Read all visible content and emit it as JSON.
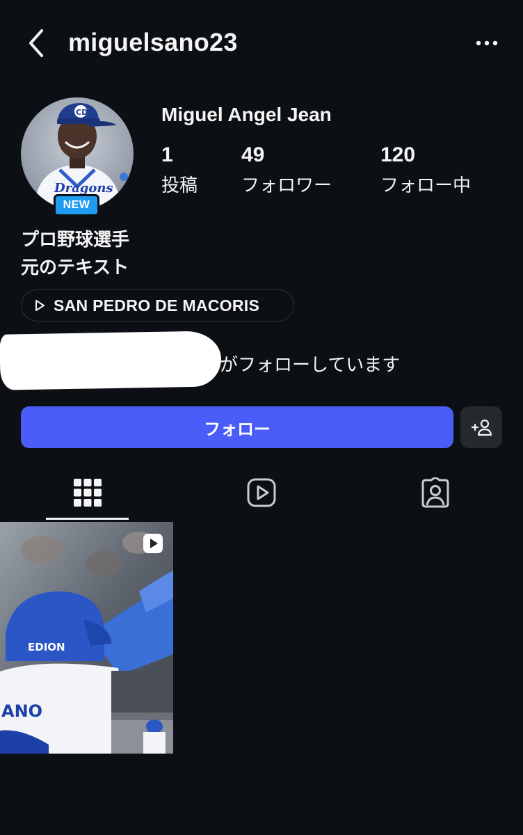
{
  "header": {
    "username": "miguelsano23",
    "back_icon": "chevron-left-icon",
    "more_icon": "more-horizontal-icon"
  },
  "profile": {
    "avatar_badge": "NEW",
    "display_name": "Miguel Angel Jean",
    "stats": [
      {
        "value": "1",
        "label": "投稿"
      },
      {
        "value": "49",
        "label": "フォロワー"
      },
      {
        "value": "120",
        "label": "フォロー中"
      }
    ],
    "bio": [
      "プロ野球選手",
      "元のテキスト"
    ],
    "location": "SAN PEDRO DE MACORIS",
    "followed_by_text": "がフォローしています"
  },
  "actions": {
    "follow_label": "フォロー",
    "suggest_icon": "add-person-icon"
  },
  "tabs": [
    {
      "name": "grid",
      "icon": "grid-icon",
      "selected": true
    },
    {
      "name": "reels",
      "icon": "reels-icon",
      "selected": false
    },
    {
      "name": "tagged",
      "icon": "tagged-person-icon",
      "selected": false
    }
  ],
  "posts": [
    {
      "type": "reel",
      "icon": "reel-play-icon",
      "helmet_text": "EDION",
      "jersey_text": "ANO"
    }
  ],
  "colors": {
    "background": "#0c1014",
    "text": "#f5f5f5",
    "follow_button": "#4a5df9",
    "secondary_button": "#25292e",
    "new_badge": "#1f9cf0"
  }
}
